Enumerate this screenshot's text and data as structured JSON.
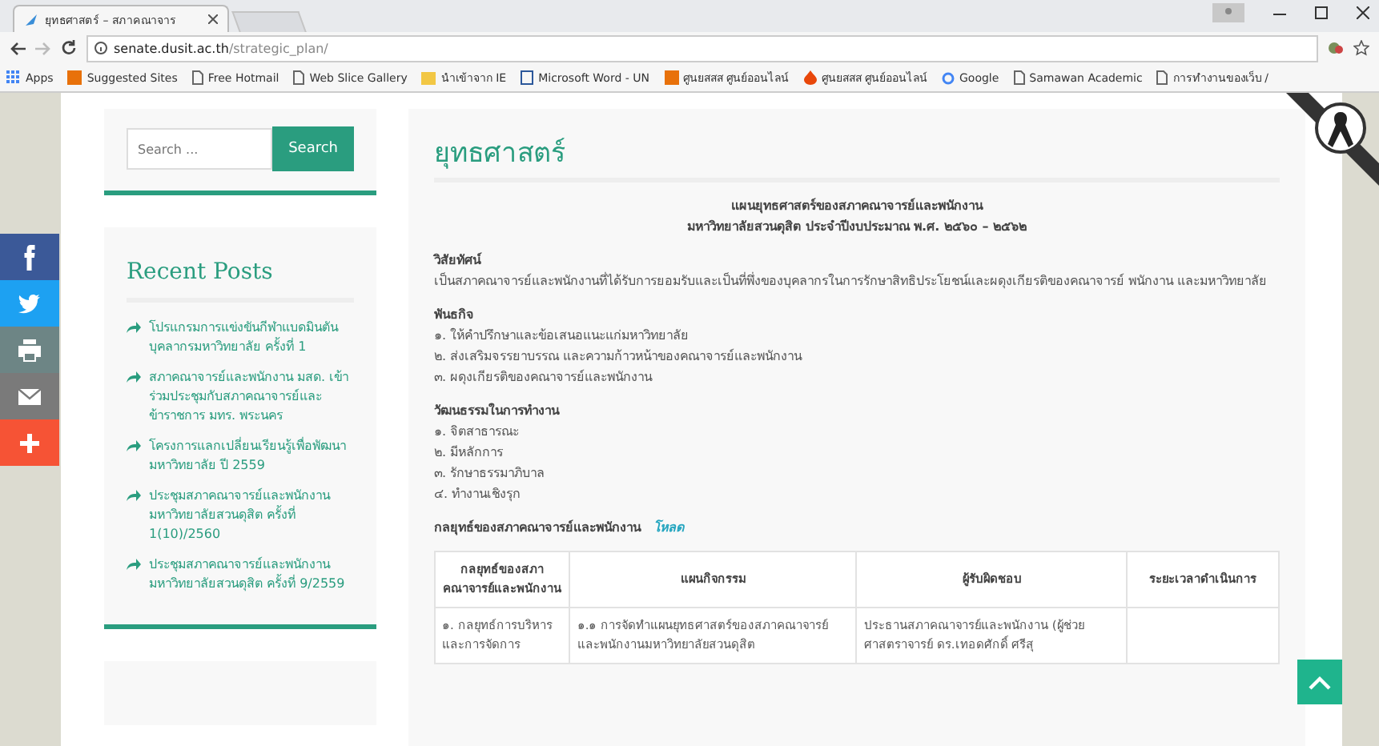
{
  "browser": {
    "tab_title": "ยุทธศาสตร์ – สภาคณาจาร",
    "url_host": "senate.dusit.ac.th",
    "url_path": "/strategic_plan/",
    "bookmarks": [
      {
        "kind": "apps",
        "label": "Apps"
      },
      {
        "kind": "site",
        "label": "Suggested Sites"
      },
      {
        "kind": "page",
        "label": "Free Hotmail"
      },
      {
        "kind": "page",
        "label": "Web Slice Gallery"
      },
      {
        "kind": "folder",
        "label": "นำเข้าจาก IE"
      },
      {
        "kind": "doc",
        "label": "Microsoft Word - UN"
      },
      {
        "kind": "site",
        "label": "ศูนยสสส ศูนย์ออนไลน์"
      },
      {
        "kind": "fire",
        "label": "ศูนยสสส ศูนย์ออนไลน์"
      },
      {
        "kind": "google",
        "label": "Google"
      },
      {
        "kind": "page",
        "label": "Samawan Academic"
      },
      {
        "kind": "page",
        "label": "การทำงานของเว็บ /"
      }
    ]
  },
  "social_bar": [
    {
      "kind": "facebook"
    },
    {
      "kind": "twitter"
    },
    {
      "kind": "print"
    },
    {
      "kind": "email"
    },
    {
      "kind": "more"
    }
  ],
  "sidebar": {
    "search": {
      "placeholder": "Search ...",
      "button": "Search"
    },
    "recent_posts": {
      "title": "Recent Posts",
      "items": [
        "โปรแกรมการแข่งขันกีฬาแบดมินตันบุคลากรมหาวิทยาลัย ครั้งที่ 1",
        "สภาคณาจารย์และพนักงาน มสด. เข้าร่วมประชุมกับสภาคณาจารย์และข้าราชการ มทร. พระนคร",
        "โครงการแลกเปลี่ยนเรียนรู้เพื่อพัฒนามหาวิทยาลัย ปี 2559",
        "ประชุมสภาคณาจารย์และพนักงานมหาวิทยาลัยสวนดุสิต ครั้งที่ 1(10)/2560",
        "ประชุมสภาคณาจารย์และพนักงานมหาวิทยาลัยสวนดุสิต ครั้งที่ 9/2559"
      ]
    }
  },
  "main": {
    "title": "ยุทธศาสตร์",
    "heading_lines": [
      "แผนยุทธศาสตร์ของสภาคณาจารย์และพนักงาน",
      "มหาวิทยาลัยสวนดุสิต ประจำปีงบประมาณ พ.ศ. ๒๕๖๐ – ๒๕๖๒"
    ],
    "sections": [
      {
        "heading": "วิสัยทัศน์",
        "lines": [
          "เป็นสภาคณาจารย์และพนักงานที่ได้รับการยอมรับและเป็นที่พึ่งของบุคลากรในการรักษาสิทธิประโยชน์และผดุงเกียรติของคณาจารย์ พนักงาน และมหาวิทยาลัย"
        ]
      },
      {
        "heading": "พันธกิจ",
        "lines": [
          "๑. ให้คำปรึกษาและข้อเสนอแนะแก่มหาวิทยาลัย",
          "๒. ส่งเสริมจรรยาบรรณ และความก้าวหน้าของคณาจารย์และพนักงาน",
          "๓. ผดุงเกียรติของคณาจารย์และพนักงาน"
        ]
      },
      {
        "heading": "วัฒนธรรมในการทำงาน",
        "lines": [
          "๑. จิตสาธารณะ",
          "๒. มีหลักการ",
          "๓. รักษาธรรมาภิบาล",
          "๔. ทำงานเชิงรุก"
        ]
      }
    ],
    "strategy": {
      "label": "กลยุทธ์ของสภาคณาจารย์และพนักงาน",
      "link": "โหลด"
    },
    "table": {
      "columns": [
        "กลยุทธ์ของสภาคณาจารย์และพนักงาน",
        "แผนกิจกรรม",
        "ผู้รับผิดชอบ",
        "ระยะเวลาดำเนินการ"
      ],
      "rows": [
        [
          "๑. กลยุทธ์การบริหารและการจัดการ",
          "๑.๑ การจัดทำแผนยุทธศาสตร์ของสภาคณาจารย์และพนักงานมหาวิทยาลัยสวนดุสิต",
          "ประธานสภาคณาจารย์และพนักงาน (ผู้ช่วยศาสตราจารย์ ดร.เทอดศักดิ์ ศรีสุ",
          ""
        ]
      ]
    }
  }
}
